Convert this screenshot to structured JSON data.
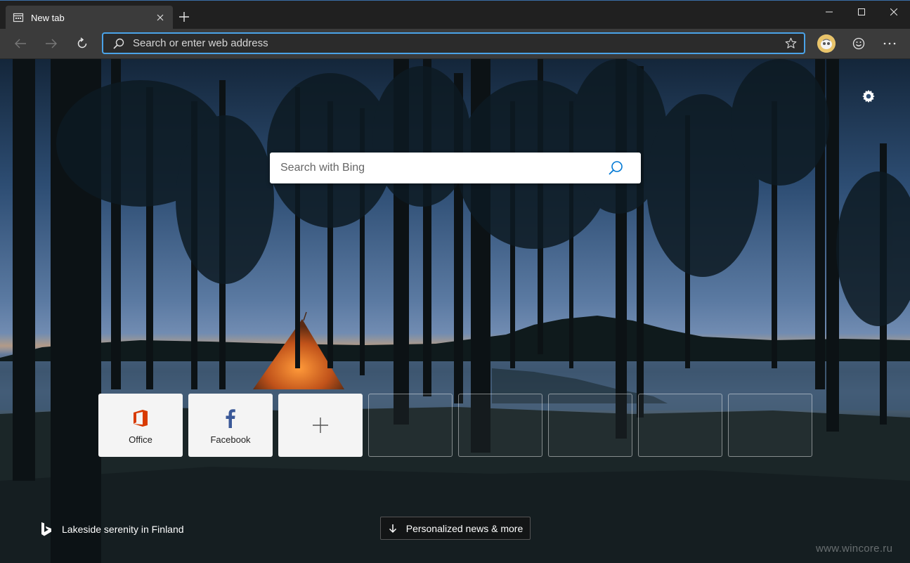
{
  "tab": {
    "title": "New tab",
    "favicon": "newtab-icon",
    "close_icon": "close-icon"
  },
  "titlebar": {
    "new_tab_icon": "plus-icon",
    "minimize_icon": "minimize-icon",
    "maximize_icon": "maximize-icon",
    "close_icon": "close-icon"
  },
  "toolbar": {
    "back_icon": "back-arrow-icon",
    "forward_icon": "forward-arrow-icon",
    "refresh_icon": "refresh-icon",
    "address_placeholder": "Search or enter web address",
    "favorite_icon": "star-icon",
    "profile_icon": "avatar",
    "feedback_icon": "smiley-icon",
    "menu_icon": "more-icon"
  },
  "newtab": {
    "settings_icon": "gear-icon",
    "search_placeholder": "Search with Bing",
    "search_icon": "search-icon",
    "tiles": [
      {
        "label": "Office",
        "icon": "office-icon"
      },
      {
        "label": "Facebook",
        "icon": "facebook-icon"
      },
      {
        "label": "",
        "icon": "plus-icon"
      }
    ],
    "empty_tile_count": 5,
    "attribution": "Lakeside serenity in Finland",
    "news_button": "Personalized news & more"
  },
  "watermark": "www.wincore.ru",
  "colors": {
    "accent": "#4aa3e8",
    "office": "#d83b01",
    "facebook": "#3b5998",
    "titlebar": "#202020",
    "toolbar": "#3b3b3b"
  }
}
